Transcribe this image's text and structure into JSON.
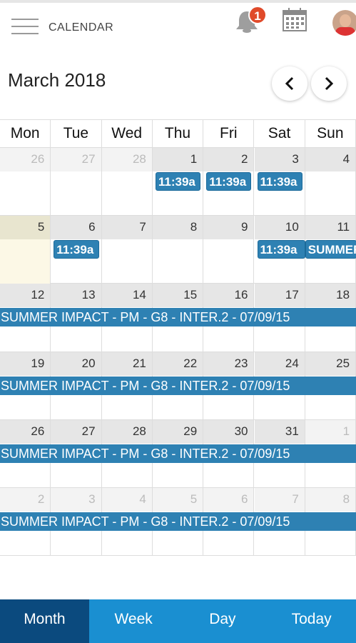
{
  "header": {
    "title": "CALENDAR",
    "notification_count": "1",
    "icons": [
      "menu-icon",
      "bell-icon",
      "calendar-icon",
      "avatar"
    ]
  },
  "calendar": {
    "month_label": "March 2018",
    "prev_icon": "chevron-left-icon",
    "next_icon": "chevron-right-icon",
    "weekdays": [
      "Mon",
      "Tue",
      "Wed",
      "Thu",
      "Fri",
      "Sat",
      "Sun"
    ],
    "weeks": [
      {
        "days": [
          "26",
          "27",
          "28",
          "1",
          "2",
          "3",
          "4"
        ],
        "other_month": [
          0,
          1,
          2
        ]
      },
      {
        "days": [
          "5",
          "6",
          "7",
          "8",
          "9",
          "10",
          "11"
        ],
        "other_month": [],
        "today_index": 0
      },
      {
        "days": [
          "12",
          "13",
          "14",
          "15",
          "16",
          "17",
          "18"
        ],
        "other_month": []
      },
      {
        "days": [
          "19",
          "20",
          "21",
          "22",
          "23",
          "24",
          "25"
        ],
        "other_month": []
      },
      {
        "days": [
          "26",
          "27",
          "28",
          "29",
          "30",
          "31",
          "1"
        ],
        "other_month": [
          6
        ]
      },
      {
        "days": [
          "2",
          "3",
          "4",
          "5",
          "6",
          "7",
          "8"
        ],
        "other_month": [
          0,
          1,
          2,
          3,
          4,
          5,
          6
        ]
      }
    ],
    "events": {
      "short_label": "11:39a",
      "sat_label": "11:39a",
      "sun_label": "SUMMER",
      "long_label": "SUMMER IMPACT - PM - G8 - INTER.2 - 07/09/15"
    }
  },
  "tabs": [
    {
      "label": "Month",
      "active": true
    },
    {
      "label": "Week",
      "active": false
    },
    {
      "label": "Day",
      "active": false
    },
    {
      "label": "Today",
      "active": false
    }
  ],
  "colors": {
    "event": "#2e81b3",
    "tab_bar": "#1a8fd1",
    "tab_active": "#0b4a7e",
    "badge": "#e04a2a",
    "today": "#fcf8e6"
  }
}
